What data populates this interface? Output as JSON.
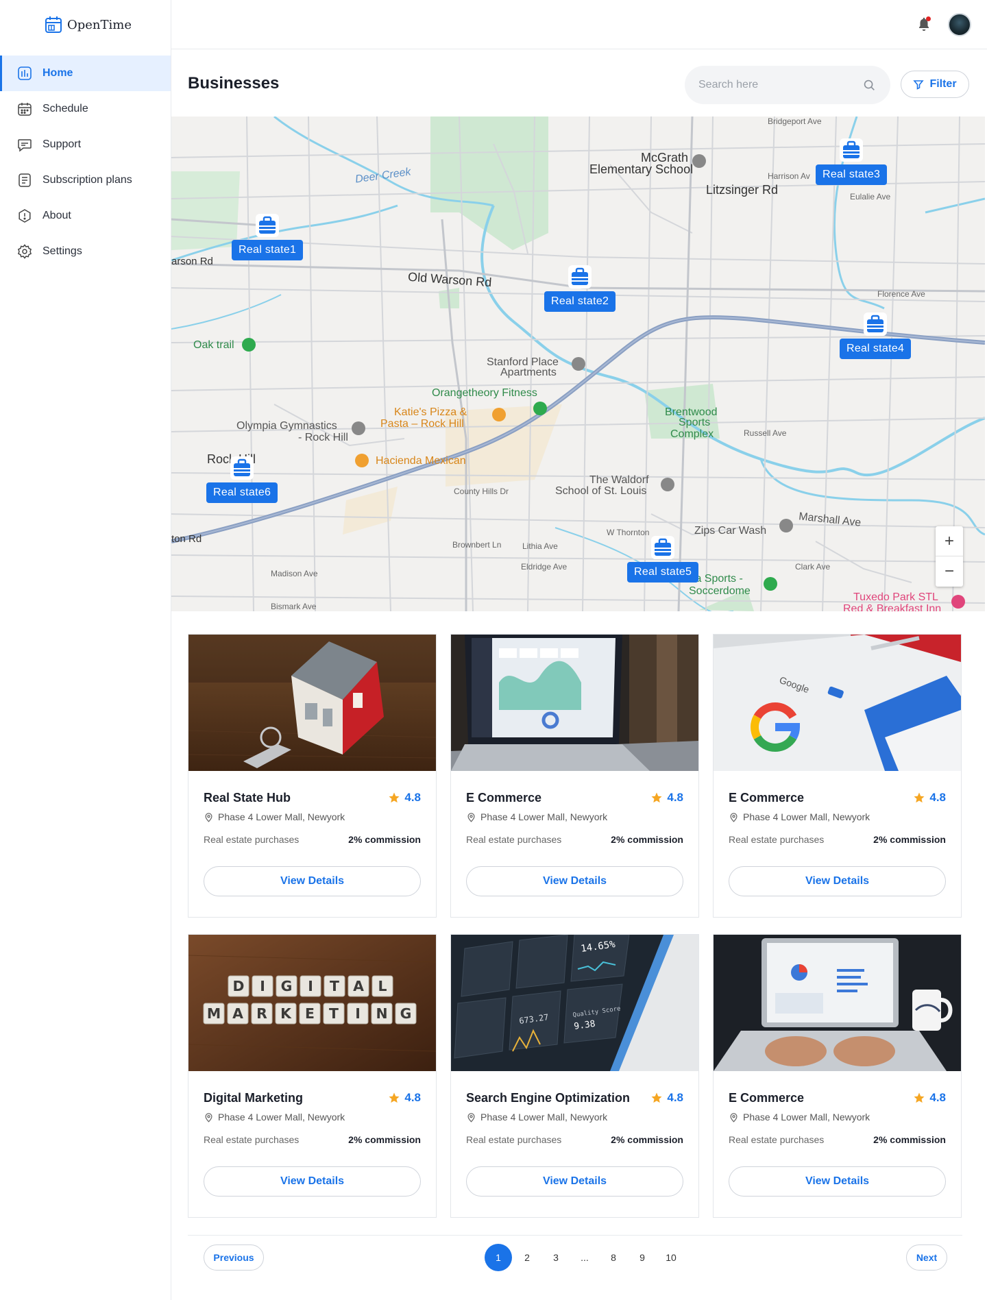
{
  "app": {
    "name": "OpenTime"
  },
  "sidebar": {
    "items": [
      {
        "label": "Home",
        "icon": "chart-bars-icon",
        "active": true
      },
      {
        "label": "Schedule",
        "icon": "calendar-icon"
      },
      {
        "label": "Support",
        "icon": "chat-icon"
      },
      {
        "label": "Subscription plans",
        "icon": "document-icon"
      },
      {
        "label": "About",
        "icon": "info-icon"
      },
      {
        "label": "Settings",
        "icon": "gear-icon"
      }
    ]
  },
  "header": {
    "title": "Businesses",
    "search_placeholder": "Search here",
    "filter_label": "Filter"
  },
  "map": {
    "pins": [
      {
        "label": "Real state1"
      },
      {
        "label": "Real state2"
      },
      {
        "label": "Real state3"
      },
      {
        "label": "Real state4"
      },
      {
        "label": "Real state5"
      },
      {
        "label": "Real state6"
      }
    ],
    "places": {
      "mcgrath": "McGrath",
      "elementary": "Elementary School",
      "litzsinger": "Litzsinger Rd",
      "harrison": "Harrison Av",
      "eulalie": "Eulalie Ave",
      "bridgeport": "Bridgeport Ave",
      "old_warson": "Old Warson Rd",
      "oak_trail": "Oak trail",
      "stanford": "Stanford Place",
      "apartments": "Apartments",
      "orangetheory": "Orangetheory Fitness",
      "katies": "Katie's Pizza &",
      "pasta": "Pasta – Rock Hill",
      "olympia": "Olympia Gymnastics",
      "rock_hill_sub": "- Rock Hill",
      "hacienda": "Hacienda Mexican",
      "rock_hill": "Rock Hill",
      "brentwood1": "Brentwood",
      "brentwood2": "Sports",
      "brentwood3": "Complex",
      "waldorf": "The Waldorf",
      "waldorf2": "School of St. Louis",
      "zips": "Zips Car Wash",
      "marshall": "Marshall Ave",
      "sports": "ta Sports -",
      "soccerdome": "Soccerdome",
      "tuxedo": "Tuxedo Park STL",
      "redbreakfast": "Red & Breakfast Inn",
      "deer_creek": "Deer Creek",
      "florence": "Florence Ave",
      "russell": "Russell Ave",
      "clark": "Clark Ave",
      "madison": "Madison Ave",
      "bismark": "Bismark Ave",
      "eldridge": "Eldridge Ave",
      "lithia": "Lithia Ave",
      "thornton": "W Thornton",
      "county_hills": "County Hills Dr",
      "brownbert": "Brownbert Ln",
      "arson": "arson Rd",
      "ton_rd": "ton Rd"
    },
    "zoom_in": "+",
    "zoom_out": "−"
  },
  "cards": [
    {
      "title": "Real State Hub",
      "rating": "4.8",
      "address": "Phase 4 Lower Mall, Newyork",
      "type": "Real estate purchases",
      "commission": "2% commission",
      "button": "View Details"
    },
    {
      "title": "E Commerce",
      "rating": "4.8",
      "address": "Phase 4 Lower Mall, Newyork",
      "type": "Real estate purchases",
      "commission": "2% commission",
      "button": "View Details"
    },
    {
      "title": "E Commerce",
      "rating": "4.8",
      "address": "Phase 4 Lower Mall, Newyork",
      "type": "Real estate purchases",
      "commission": "2% commission",
      "button": "View Details"
    },
    {
      "title": "Digital Marketing",
      "rating": "4.8",
      "address": "Phase 4 Lower Mall, Newyork",
      "type": "Real estate purchases",
      "commission": "2% commission",
      "button": "View Details"
    },
    {
      "title": "Search Engine Optimization",
      "rating": "4.8",
      "address": "Phase 4 Lower Mall, Newyork",
      "type": "Real estate purchases",
      "commission": "2% commission",
      "button": "View Details"
    },
    {
      "title": "E Commerce",
      "rating": "4.8",
      "address": "Phase 4 Lower Mall, Newyork",
      "type": "Real estate purchases",
      "commission": "2% commission",
      "button": "View Details"
    }
  ],
  "card_photos": {
    "digital_letters_1": [
      "D",
      "I",
      "G",
      "I",
      "T",
      "A",
      "L"
    ],
    "digital_letters_2": [
      "M",
      "A",
      "R",
      "K",
      "E",
      "T",
      "I",
      "N",
      "G"
    ],
    "seo_value_1": "14.65%",
    "seo_value_2": "9.38",
    "seo_value_3": "673.27",
    "seo_label": "Quality Score",
    "google_word": "Google"
  },
  "pagination": {
    "previous": "Previous",
    "next": "Next",
    "pages": [
      "1",
      "2",
      "3",
      "...",
      "8",
      "9",
      "10"
    ],
    "current": "1"
  },
  "colors": {
    "accent": "#1a73e8",
    "star": "#f5a623",
    "active_bg": "#e6f0ff"
  }
}
